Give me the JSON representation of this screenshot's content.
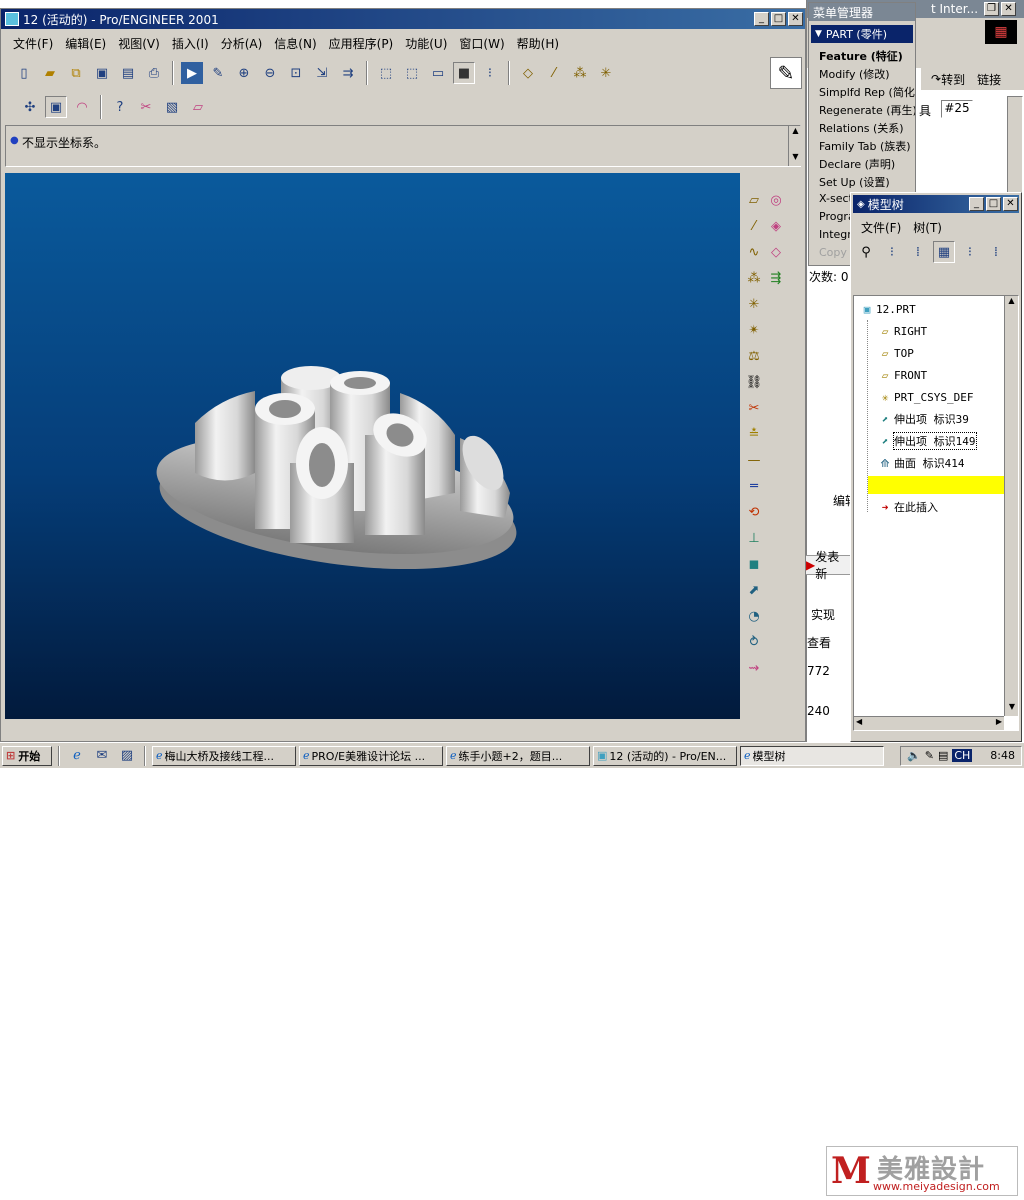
{
  "main_window": {
    "title": "12 (活动的) - Pro/ENGINEER 2001",
    "menu": [
      "文件(F)",
      "编辑(E)",
      "视图(V)",
      "插入(I)",
      "分析(A)",
      "信息(N)",
      "应用程序(P)",
      "功能(U)",
      "窗口(W)",
      "帮助(H)"
    ],
    "message": "不显示坐标系。"
  },
  "menu_manager": {
    "title": "菜单管理器",
    "header": "PART (零件)",
    "items": [
      "Feature (特征)",
      "Modify (修改)",
      "Simplfd Rep (简化表",
      "Regenerate (再生)",
      "Relations (关系)",
      "Family Tab (族表)",
      "Declare (声明)",
      "Set Up (设置)",
      "X-sect",
      "Progra",
      "Integr",
      "Copy"
    ]
  },
  "model_tree": {
    "title": "模型树",
    "menu": [
      "文件(F)",
      "树(T)"
    ],
    "root": "12.PRT",
    "items": [
      {
        "label": "RIGHT",
        "icon": "datum-plane-icon"
      },
      {
        "label": "TOP",
        "icon": "datum-plane-icon"
      },
      {
        "label": "FRONT",
        "icon": "datum-plane-icon"
      },
      {
        "label": "PRT_CSYS_DEF",
        "icon": "csys-icon"
      },
      {
        "label": "伸出项 标识39",
        "icon": "protrusion-icon"
      },
      {
        "label": "伸出项 标识149",
        "icon": "protrusion-icon"
      },
      {
        "label": "曲面 标识414",
        "icon": "surface-icon"
      }
    ],
    "insert_here": "在此插入"
  },
  "background_browser": {
    "title": "t Inter...",
    "goto": "转到",
    "link": "链接",
    "tool_text": "具",
    "post_number": "#25",
    "count_label": "次数: 0",
    "edit": "编辑",
    "post_button": "发表新",
    "text1": "实现",
    "text2": "查看",
    "num1": "772",
    "num2": "240"
  },
  "taskbar": {
    "start": "开始",
    "tasks": [
      "梅山大桥及接线工程...",
      "PRO/E美雅设计论坛 ...",
      "练手小题+2，题目...",
      "12 (活动的) - Pro/EN...",
      "模型树"
    ],
    "tray_lang": "CH",
    "clock": "8:48"
  },
  "watermark": {
    "brand": "美雅設計",
    "url": "www.meiyadesign.com"
  },
  "colors": {
    "chrome": "#d4d0c8",
    "title_active": "#0a246a",
    "viewport_top": "#0a5a9c",
    "viewport_bottom": "#021a3c",
    "highlight": "#ffff00"
  }
}
